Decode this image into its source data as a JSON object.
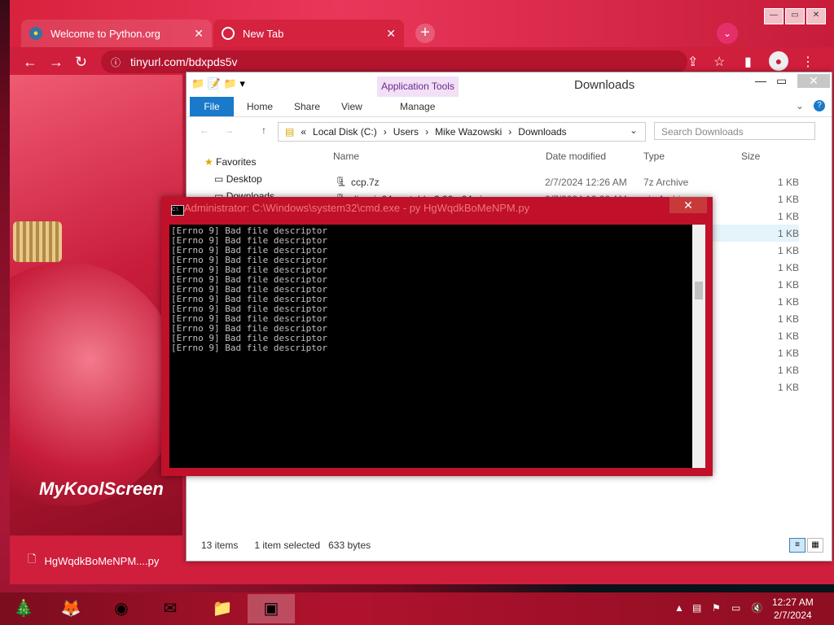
{
  "browser": {
    "tabs": [
      {
        "label": "Welcome to Python.org"
      },
      {
        "label": "New Tab"
      }
    ],
    "url": "tinyurl.com/bdxpds5v",
    "page_brand": "MyKoolScreen",
    "download": {
      "filename": "HgWqdkBoMeNPM....py"
    }
  },
  "explorer": {
    "title": "Downloads",
    "app_tools": "Application Tools",
    "ribbon_tabs": [
      "File",
      "Home",
      "Share",
      "View",
      "Manage"
    ],
    "breadcrumb": [
      "Local Disk (C:)",
      "Users",
      "Mike Wazowski",
      "Downloads"
    ],
    "search_placeholder": "Search Downloads",
    "nav": {
      "favorites": "Favorites",
      "desktop": "Desktop",
      "downloads": "Downloads"
    },
    "columns": {
      "name": "Name",
      "date": "Date modified",
      "type": "Type",
      "size": "Size"
    },
    "rows": [
      {
        "name": "ccp.7z",
        "date": "2/7/2024 12:26 AM",
        "type": "7z Archive",
        "size": "1 KB"
      },
      {
        "name": "dic-win64-portable-3.99-x64.zip",
        "date": "2/7/2024 12:26 AM",
        "type": "zip Archive",
        "size": "1 KB"
      },
      {
        "name": "",
        "date": "",
        "type": "",
        "size": "1 KB"
      },
      {
        "name": "",
        "date": "",
        "type": "",
        "size": "1 KB"
      },
      {
        "name": "",
        "date": "",
        "type": "",
        "size": "1 KB"
      },
      {
        "name": "",
        "date": "",
        "type": "",
        "size": "1 KB"
      },
      {
        "name": "",
        "date": "",
        "type": "",
        "size": "1 KB"
      },
      {
        "name": "",
        "date": "",
        "type": "",
        "size": "1 KB"
      },
      {
        "name": "",
        "date": "",
        "type": "",
        "size": "1 KB"
      },
      {
        "name": "",
        "date": "",
        "type": "",
        "size": "1 KB"
      },
      {
        "name": "",
        "date": "",
        "type": "",
        "size": "1 KB"
      },
      {
        "name": "",
        "date": "",
        "type": "",
        "size": "1 KB"
      },
      {
        "name": "",
        "date": "",
        "type": "",
        "size": "1 KB"
      }
    ],
    "status": {
      "items": "13 items",
      "selected": "1 item selected",
      "bytes": "633 bytes"
    }
  },
  "console": {
    "title": "Administrator: C:\\Windows\\system32\\cmd.exe - py HgWqdkBoMeNPM.py",
    "lines": [
      "[Errno 9] Bad file descriptor",
      "[Errno 9] Bad file descriptor",
      "[Errno 9] Bad file descriptor",
      "[Errno 9] Bad file descriptor",
      "[Errno 9] Bad file descriptor",
      "[Errno 9] Bad file descriptor",
      "[Errno 9] Bad file descriptor",
      "[Errno 9] Bad file descriptor",
      "[Errno 9] Bad file descriptor",
      "[Errno 9] Bad file descriptor",
      "[Errno 9] Bad file descriptor",
      "[Errno 9] Bad file descriptor",
      "[Errno 9] Bad file descriptor"
    ]
  },
  "taskbar": {
    "time": "12:27 AM",
    "date": "2/7/2024"
  }
}
